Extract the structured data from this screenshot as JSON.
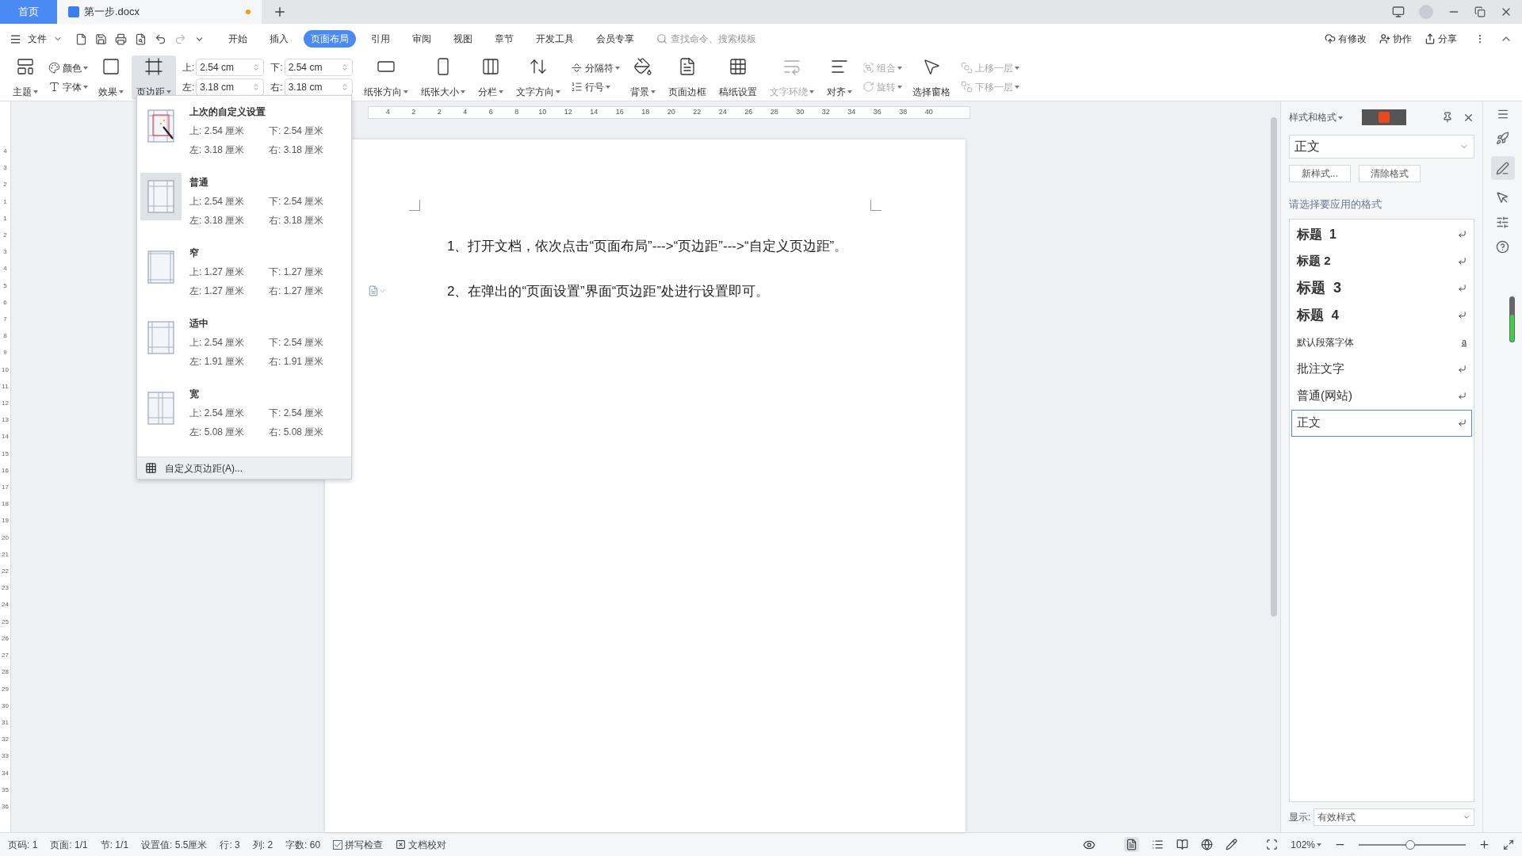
{
  "tabs": [
    {
      "label": "首页",
      "kind": "home"
    },
    {
      "label": "第一步.docx",
      "kind": "document",
      "unsaved": true
    }
  ],
  "menu": {
    "file": "文件",
    "tabs": [
      {
        "label": "开始",
        "selected": false
      },
      {
        "label": "插入",
        "selected": false
      },
      {
        "label": "页面布局",
        "selected": true
      },
      {
        "label": "引用",
        "selected": false
      },
      {
        "label": "审阅",
        "selected": false
      },
      {
        "label": "视图",
        "selected": false
      },
      {
        "label": "章节",
        "selected": false
      },
      {
        "label": "开发工具",
        "selected": false
      },
      {
        "label": "会员专享",
        "selected": false
      }
    ],
    "search_placeholder": "查找命令、搜索模板",
    "actions": [
      "有修改",
      "协作",
      "分享"
    ]
  },
  "ribbon": [
    {
      "kind": "large",
      "label": "主题",
      "caret": true,
      "disabled": false,
      "pressed": false
    },
    {
      "kind": "stack",
      "items": [
        {
          "label": "颜色",
          "caret": true,
          "disabled": false
        },
        {
          "label": "字体",
          "caret": true,
          "disabled": false
        }
      ]
    },
    {
      "kind": "large",
      "label": "效果",
      "caret": true,
      "disabled": false,
      "pressed": false
    },
    {
      "kind": "large",
      "label": "页边距",
      "caret": true,
      "disabled": false,
      "pressed": true
    },
    {
      "kind": "fields",
      "fields": [
        {
          "label": "上:",
          "value": "2.54 cm"
        },
        {
          "label": "下:",
          "value": "2.54 cm"
        },
        {
          "label": "左:",
          "value": "3.18 cm"
        },
        {
          "label": "右:",
          "value": "3.18 cm"
        }
      ]
    },
    {
      "kind": "large",
      "label": "纸张方向",
      "caret": true,
      "disabled": false,
      "pressed": false
    },
    {
      "kind": "large",
      "label": "纸张大小",
      "caret": true,
      "disabled": false,
      "pressed": false
    },
    {
      "kind": "large",
      "label": "分栏",
      "caret": true,
      "disabled": false,
      "pressed": false
    },
    {
      "kind": "large",
      "label": "文字方向",
      "caret": true,
      "disabled": false,
      "pressed": false
    },
    {
      "kind": "stack",
      "items": [
        {
          "label": "分隔符",
          "caret": true,
          "disabled": false
        },
        {
          "label": "行号",
          "caret": true,
          "disabled": false
        }
      ]
    },
    {
      "kind": "large",
      "label": "背景",
      "caret": true,
      "disabled": false,
      "pressed": false
    },
    {
      "kind": "large",
      "label": "页面边框",
      "caret": false,
      "disabled": false,
      "pressed": false
    },
    {
      "kind": "large",
      "label": "稿纸设置",
      "caret": false,
      "disabled": false,
      "pressed": false
    },
    {
      "kind": "large",
      "label": "文字环绕",
      "caret": true,
      "disabled": true,
      "pressed": false
    },
    {
      "kind": "large",
      "label": "对齐",
      "caret": true,
      "disabled": false,
      "pressed": false
    },
    {
      "kind": "stack",
      "items": [
        {
          "label": "组合",
          "caret": true,
          "disabled": true
        },
        {
          "label": "旋转",
          "caret": true,
          "disabled": true
        }
      ]
    },
    {
      "kind": "large",
      "label": "选择窗格",
      "caret": false,
      "disabled": false,
      "pressed": false
    },
    {
      "kind": "stack",
      "items": [
        {
          "label": "上移一层",
          "caret": true,
          "disabled": true
        },
        {
          "label": "下移一层",
          "caret": true,
          "disabled": true
        }
      ]
    }
  ],
  "margin_menu": {
    "presets": [
      {
        "name": "上次的自定义设置",
        "kind": "custom",
        "selected": false,
        "top": "上: 2.54 厘米",
        "bottom": "下: 2.54 厘米",
        "left": "左: 3.18 厘米",
        "right": "右: 3.18 厘米"
      },
      {
        "name": "普通",
        "kind": "normal",
        "selected": true,
        "top": "上: 2.54 厘米",
        "bottom": "下: 2.54 厘米",
        "left": "左: 3.18 厘米",
        "right": "右: 3.18 厘米"
      },
      {
        "name": "窄",
        "kind": "narrow",
        "selected": false,
        "top": "上: 1.27 厘米",
        "bottom": "下: 1.27 厘米",
        "left": "左: 1.27 厘米",
        "right": "右: 1.27 厘米"
      },
      {
        "name": "适中",
        "kind": "moderate",
        "selected": false,
        "top": "上: 2.54 厘米",
        "bottom": "下: 2.54 厘米",
        "left": "左: 1.91 厘米",
        "right": "右: 1.91 厘米"
      },
      {
        "name": "宽",
        "kind": "wide",
        "selected": false,
        "top": "上: 2.54 厘米",
        "bottom": "下: 2.54 厘米",
        "left": "左: 5.08 厘米",
        "right": "右: 5.08 厘米"
      }
    ],
    "custom": "自定义页边距(A)..."
  },
  "ruler": {
    "horizontal": [
      "4",
      "2",
      "2",
      "4",
      "6",
      "8",
      "10",
      "12",
      "14",
      "16",
      "18",
      "20",
      "22",
      "24",
      "26",
      "28",
      "30",
      "32",
      "34",
      "36",
      "38",
      "40"
    ],
    "vertical": [
      "4",
      "3",
      "2",
      "1",
      "1",
      "2",
      "3",
      "4",
      "5",
      "6",
      "7",
      "8",
      "9",
      "10",
      "11",
      "12",
      "13",
      "14",
      "15",
      "16",
      "17",
      "18",
      "19",
      "20",
      "21",
      "22",
      "23",
      "24",
      "25",
      "26",
      "27",
      "28",
      "29",
      "30",
      "31",
      "32",
      "33",
      "34",
      "35",
      "36"
    ]
  },
  "document": {
    "paragraphs": [
      "1、打开文档，依次点击“页面布局”--->“页边距”--->“自定义页边距”。",
      "2、在弹出的“页面设置”界面“页边距”处进行设置即可。"
    ]
  },
  "styles_panel": {
    "title": "样式和格式",
    "current": "正文",
    "buttons": [
      "新样式...",
      "清除格式"
    ],
    "prompt": "请选择要应用的格式",
    "styles": [
      {
        "label": "标题  1",
        "kind": "h1",
        "selected": false
      },
      {
        "label": "标题 2",
        "kind": "h2",
        "selected": false
      },
      {
        "label": "标题  3",
        "kind": "h3",
        "selected": false
      },
      {
        "label": "标题  4",
        "kind": "h4",
        "selected": false
      },
      {
        "label": "默认段落字体",
        "kind": "font",
        "selected": false,
        "mark": "a"
      },
      {
        "label": "批注文字",
        "kind": "para",
        "selected": false
      },
      {
        "label": "普通(网站)",
        "kind": "para",
        "selected": false
      },
      {
        "label": "正文",
        "kind": "para",
        "selected": true
      }
    ],
    "show_label": "显示:",
    "show_value": "有效样式"
  },
  "status_bar": {
    "items": [
      {
        "kind": "text",
        "label": "页码: 1"
      },
      {
        "kind": "text",
        "label": "页面: 1/1"
      },
      {
        "kind": "text",
        "label": "节: 1/1"
      },
      {
        "kind": "text",
        "label": "设置值: 5.5厘米"
      },
      {
        "kind": "text",
        "label": "行: 3"
      },
      {
        "kind": "text",
        "label": "列: 2"
      },
      {
        "kind": "text",
        "label": "字数: 60"
      },
      {
        "kind": "check",
        "label": "拼写检查"
      },
      {
        "kind": "proof",
        "label": "文档校对"
      }
    ],
    "zoom": "102%",
    "zoom_level": {
      "level": 0.48
    }
  }
}
